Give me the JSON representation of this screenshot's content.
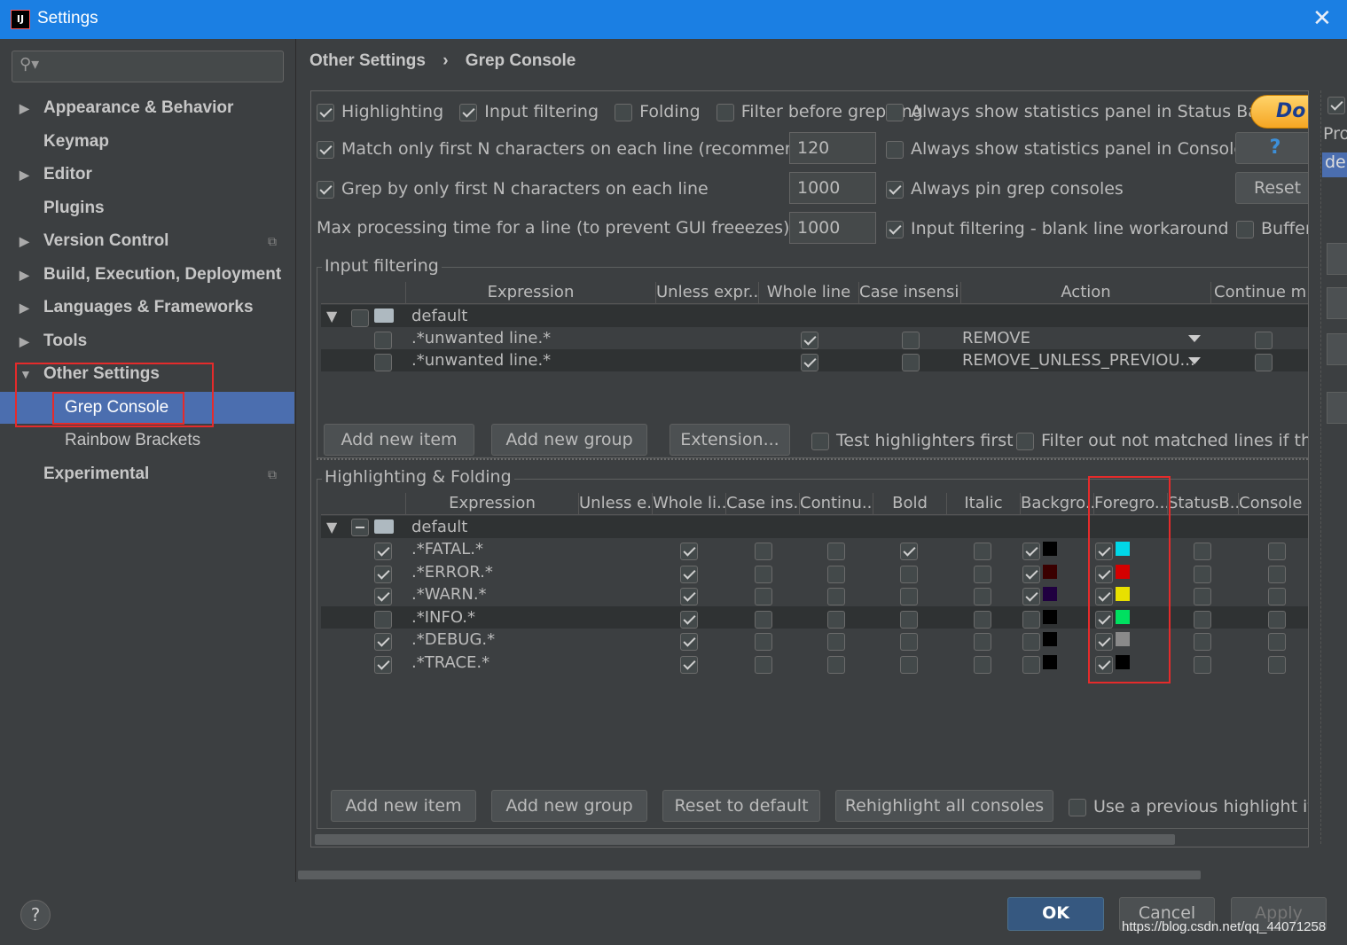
{
  "window": {
    "title": "Settings",
    "logo_text": "IJ"
  },
  "sidebar": {
    "search_placeholder": "",
    "items": [
      {
        "label": "Appearance & Behavior"
      },
      {
        "label": "Keymap"
      },
      {
        "label": "Editor"
      },
      {
        "label": "Plugins"
      },
      {
        "label": "Version Control"
      },
      {
        "label": "Build, Execution, Deployment"
      },
      {
        "label": "Languages & Frameworks"
      },
      {
        "label": "Tools"
      },
      {
        "label": "Other Settings"
      },
      {
        "label": "Grep Console"
      },
      {
        "label": "Rainbow Brackets"
      },
      {
        "label": "Experimental"
      }
    ]
  },
  "breadcrumb": {
    "parent": "Other Settings",
    "sep": "›",
    "current": "Grep Console"
  },
  "options": {
    "highlighting": "Highlighting",
    "input_filtering": "Input filtering",
    "folding": "Folding",
    "filter_before": "Filter before grepping",
    "stats_status_bar": "Always show statistics panel in Status Bar",
    "match_first_n": "Match only first N characters on each line (recommended)",
    "match_first_n_value": "120",
    "stats_console": "Always show statistics panel in Console",
    "grep_first_n": "Grep by only first N characters on each line",
    "grep_first_n_value": "1000",
    "pin_consoles": "Always pin grep consoles",
    "max_time": "Max processing time for a line (to prevent GUI freeezes) [ms]",
    "max_time_value": "1000",
    "blank_line": "Input filtering - blank line workaround",
    "donate": "Do",
    "help_q": "?",
    "reset": "Reset a",
    "buffer": "Buffer"
  },
  "input_filtering": {
    "title": "Input filtering",
    "headers": [
      "Expression",
      "Unless expr...",
      "Whole line",
      "Case insensi...",
      "Action",
      "Continue m..."
    ],
    "group": "default",
    "rows": [
      {
        "expr": ".*unwanted line.*",
        "action": "REMOVE"
      },
      {
        "expr": ".*unwanted line.*",
        "action": "REMOVE_UNLESS_PREVIOU..."
      }
    ],
    "buttons": {
      "add_item": "Add new item",
      "add_group": "Add new group",
      "extension": "Extension..."
    },
    "test_first": "Test highlighters first",
    "filter_out": "Filter out not matched lines if the p"
  },
  "highlighting": {
    "title": "Highlighting & Folding",
    "headers": [
      "Expression",
      "Unless e...",
      "Whole li...",
      "Case ins...",
      "Continu...",
      "Bold",
      "Italic",
      "Backgro...",
      "Foregro...",
      "StatusB...",
      "Console ..."
    ],
    "group": "default",
    "rows": [
      {
        "expr": ".*FATAL.*",
        "bg": "#000000",
        "fg": "#00d8e8"
      },
      {
        "expr": ".*ERROR.*",
        "bg": "#3a0000",
        "fg": "#d40000"
      },
      {
        "expr": ".*WARN.*",
        "bg": "#200040",
        "fg": "#e8e000"
      },
      {
        "expr": ".*INFO.*",
        "bg": "#000000",
        "fg": "#00e060"
      },
      {
        "expr": ".*DEBUG.*",
        "bg": "#000000",
        "fg": "#8a8a8a"
      },
      {
        "expr": ".*TRACE.*",
        "bg": "#000000",
        "fg": "#000000"
      }
    ],
    "buttons": {
      "add_item": "Add new item",
      "add_group": "Add new group",
      "reset": "Reset to default",
      "rehighlight": "Rehighlight all consoles"
    },
    "use_previous": "Use a previous highlight if a"
  },
  "right_strip": {
    "pro": "Pro",
    "de": "de"
  },
  "footer": {
    "help": "?",
    "ok": "OK",
    "cancel": "Cancel",
    "apply": "Apply"
  },
  "watermark": "https://blog.csdn.net/qq_44071258"
}
